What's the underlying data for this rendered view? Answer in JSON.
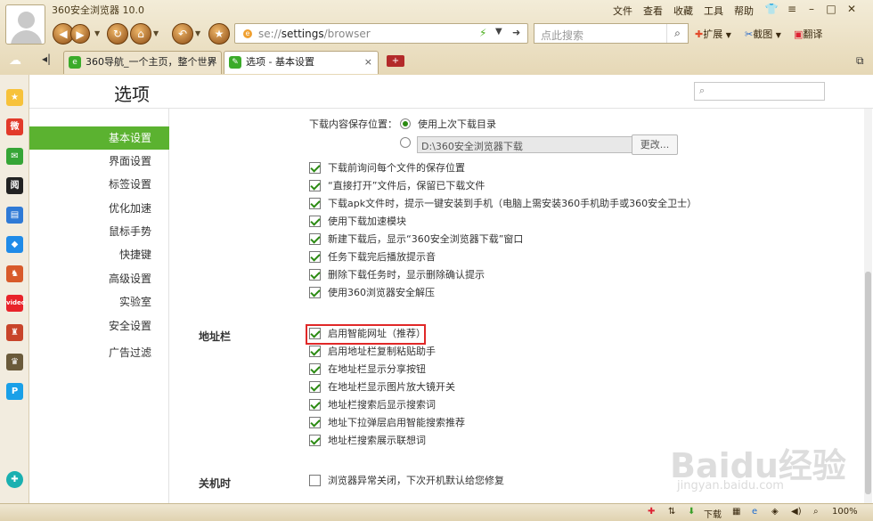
{
  "window": {
    "title": "360安全浏览器 10.0"
  },
  "menu": [
    "文件",
    "查看",
    "收藏",
    "工具",
    "帮助"
  ],
  "address": {
    "scheme": "se://",
    "path": "settings",
    "suffix": "/browser"
  },
  "search": {
    "placeholder": "点此搜索"
  },
  "toolbar": {
    "extensions": "扩展",
    "screenshot": "截图",
    "translate": "翻译"
  },
  "tabs": [
    {
      "label": "360导航_一个主页，整个世界",
      "close": "×"
    },
    {
      "label": "选项 - 基本设置",
      "close": "×"
    }
  ],
  "page": {
    "title": "选项"
  },
  "nav": [
    "基本设置",
    "界面设置",
    "标签设置",
    "优化加速",
    "鼠标手势",
    "快捷键",
    "高级设置",
    "实验室",
    "安全设置",
    "广告过滤"
  ],
  "download": {
    "location_label": "下载内容保存位置：",
    "use_last": "使用上次下载目录",
    "custom_path": "D:\\360安全浏览器下载",
    "change_btn": "更改...",
    "options": [
      "下载前询问每个文件的保存位置",
      "“直接打开”文件后，保留已下载文件",
      "下载apk文件时，提示一键安装到手机（电脑上需安装360手机助手或360安全卫士）",
      "使用下载加速模块",
      "新建下载后，显示“360安全浏览器下载”窗口",
      "任务下载完后播放提示音",
      "删除下载任务时，显示删除确认提示",
      "使用360浏览器安全解压"
    ]
  },
  "addressbar": {
    "label": "地址栏",
    "options": [
      "启用智能网址（推荐）",
      "启用地址栏复制粘贴助手",
      "在地址栏显示分享按钮",
      "在地址栏显示图片放大镜开关",
      "地址栏搜索后显示搜索词",
      "地址下拉弹层启用智能搜索推荐",
      "地址栏搜索展示联想词"
    ]
  },
  "shutdown": {
    "label": "关机时",
    "option": "浏览器异常关闭，下次开机默认给您修复"
  },
  "statusbar": {
    "download": "下载",
    "zoom": "100%"
  },
  "watermark": {
    "brand": "Baidu经验",
    "url": "jingyan.baidu.com"
  }
}
